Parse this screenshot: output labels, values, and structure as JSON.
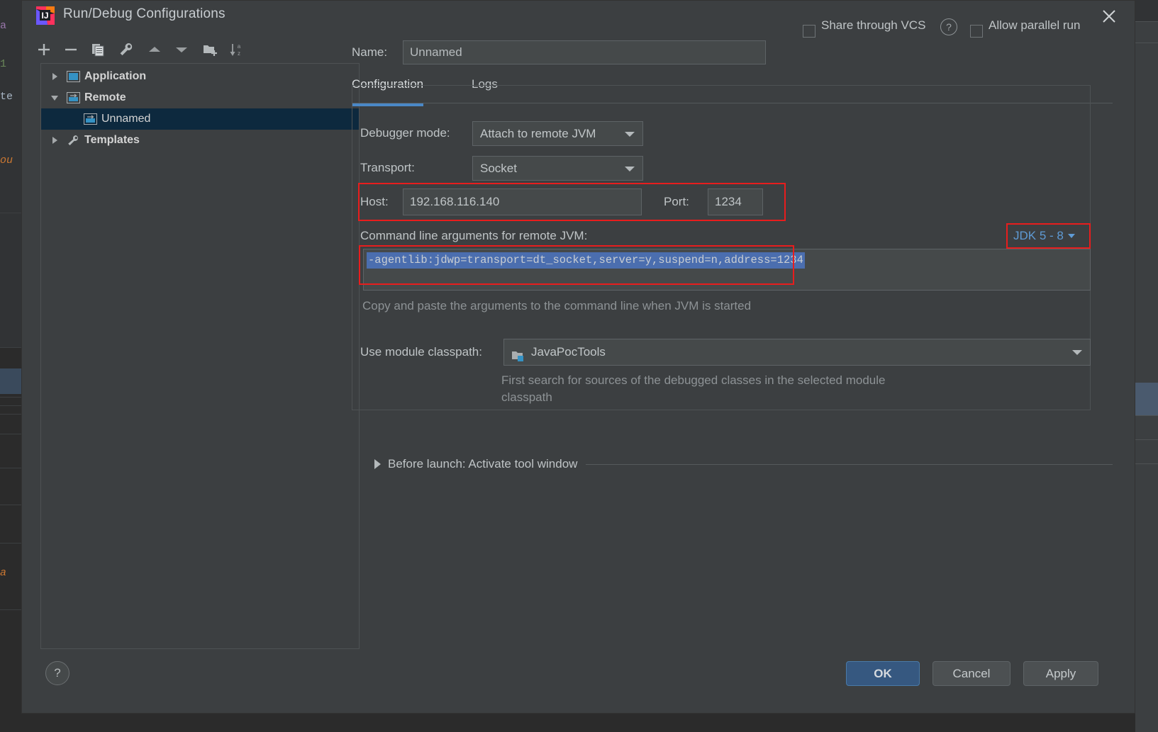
{
  "window": {
    "title": "Run/Debug Configurations",
    "app_icon": "intellij-idea-icon",
    "close_icon": "close-icon"
  },
  "toolbar": {
    "items": [
      {
        "name": "add-icon",
        "glyph": "+"
      },
      {
        "name": "remove-icon",
        "glyph": "−"
      },
      {
        "name": "copy-icon",
        "glyph": "copy"
      },
      {
        "name": "edit-templates-icon",
        "glyph": "wrench"
      },
      {
        "name": "move-up-icon",
        "glyph": "▲"
      },
      {
        "name": "move-down-icon",
        "glyph": "▼"
      },
      {
        "name": "new-folder-icon",
        "glyph": "folder-plus"
      },
      {
        "name": "sort-alphabetically-icon",
        "glyph": "sort-az"
      }
    ]
  },
  "tree": {
    "items": [
      {
        "label": "Application",
        "icon": "application-icon",
        "expanded": false,
        "selected": false,
        "indent": 0,
        "bold": true
      },
      {
        "label": "Remote",
        "icon": "remote-icon",
        "expanded": true,
        "selected": false,
        "indent": 0,
        "bold": true
      },
      {
        "label": "Unnamed",
        "icon": "remote-icon",
        "expanded": null,
        "selected": true,
        "indent": 1,
        "bold": false
      },
      {
        "label": "Templates",
        "icon": "wrench-icon",
        "expanded": false,
        "selected": false,
        "indent": 0,
        "bold": true
      }
    ]
  },
  "help_button": {
    "label": "?"
  },
  "header": {
    "name_label": "Name:",
    "name_value": "Unnamed",
    "share_label": "Share through VCS",
    "share_checked": false,
    "share_help_label": "?",
    "parallel_label": "Allow parallel run",
    "parallel_checked": false
  },
  "tabs": [
    {
      "label": "Configuration",
      "active": true
    },
    {
      "label": "Logs",
      "active": false
    }
  ],
  "config": {
    "debugger_mode_label": "Debugger mode:",
    "debugger_mode_value": "Attach to remote JVM",
    "transport_label": "Transport:",
    "transport_value": "Socket",
    "host_label": "Host:",
    "host_value": "192.168.116.140",
    "port_label": "Port:",
    "port_value": "1234",
    "args_label": "Command line arguments for remote JVM:",
    "args_value": "-agentlib:jdwp=transport=dt_socket,server=y,suspend=n,address=1234",
    "args_hint": "Copy and paste the arguments to the command line when JVM is started",
    "jdk_badge": "JDK 5 - 8",
    "module_label": "Use module classpath:",
    "module_value": "JavaPocTools",
    "module_icon": "module-icon",
    "module_hint": "First search for sources of the debugged classes in the selected module classpath"
  },
  "before_launch": {
    "label": "Before launch: Activate tool window",
    "expanded": false
  },
  "footer": {
    "ok": "OK",
    "cancel": "Cancel",
    "apply": "Apply"
  },
  "colors": {
    "accent": "#4a88c7",
    "highlight_border": "#e81d1d",
    "selection": "#0d293e",
    "link": "#5f9bd5",
    "text_selection": "#4b6eaf"
  }
}
